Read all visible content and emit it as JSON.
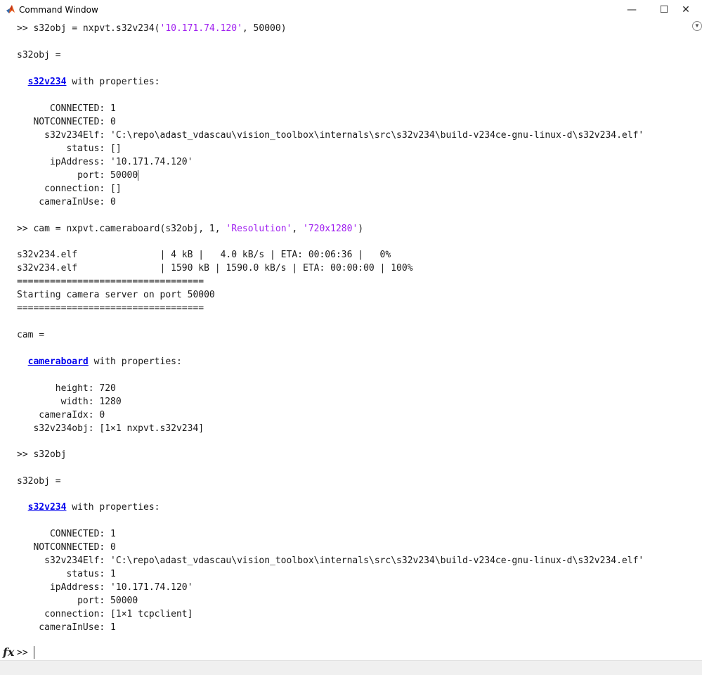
{
  "window": {
    "title": "Command Window",
    "minimize": "—",
    "maximize": "☐",
    "close": "✕",
    "options_icon": "▼"
  },
  "console": {
    "l01": ">> s32obj = nxpvt.s32v234(",
    "l01_str": "'10.171.74.120'",
    "l01_end": ", 50000)",
    "l02": "s32obj =",
    "l03_link": "s32v234",
    "l03_rest": " with properties:",
    "l04": "      CONNECTED: 1",
    "l05": "   NOTCONNECTED: 0",
    "l06": "     s32v234Elf: 'C:\\repo\\adast_vdascau\\vision_toolbox\\internals\\src\\s32v234\\build-v234ce-gnu-linux-d\\s32v234.elf'",
    "l07": "         status: []",
    "l08": "      ipAddress: '10.171.74.120'",
    "l09": "           port: 50000",
    "l10": "     connection: []",
    "l11": "    cameraInUse: 0",
    "l12": ">> cam = nxpvt.cameraboard(s32obj, 1, ",
    "l12_str1": "'Resolution'",
    "l12_mid": ", ",
    "l12_str2": "'720x1280'",
    "l12_end": ")",
    "l13": "s32v234.elf               | 4 kB |   4.0 kB/s | ETA: 00:06:36 |   0%",
    "l14": "s32v234.elf               | 1590 kB | 1590.0 kB/s | ETA: 00:00:00 | 100%",
    "l15": "==================================",
    "l16": "Starting camera server on port 50000",
    "l17": "==================================",
    "l18": "cam =",
    "l19_link": "cameraboard",
    "l19_rest": " with properties:",
    "l20": "       height: 720",
    "l21": "        width: 1280",
    "l22": "    cameraIdx: 0",
    "l23": "   s32v234obj: [1×1 nxpvt.s32v234]",
    "l24": ">> s32obj",
    "l25": "s32obj =",
    "l26_link": "s32v234",
    "l26_rest": " with properties:",
    "l27": "      CONNECTED: 1",
    "l28": "   NOTCONNECTED: 0",
    "l29": "     s32v234Elf: 'C:\\repo\\adast_vdascau\\vision_toolbox\\internals\\src\\s32v234\\build-v234ce-gnu-linux-d\\s32v234.elf'",
    "l30": "         status: 1",
    "l31": "      ipAddress: '10.171.74.120'",
    "l32": "           port: 50000",
    "l33": "     connection: [1×1 tcpclient]",
    "l34": "    cameraInUse: 1"
  },
  "prompt": {
    "fx": "fx",
    "symbol": ">>"
  }
}
